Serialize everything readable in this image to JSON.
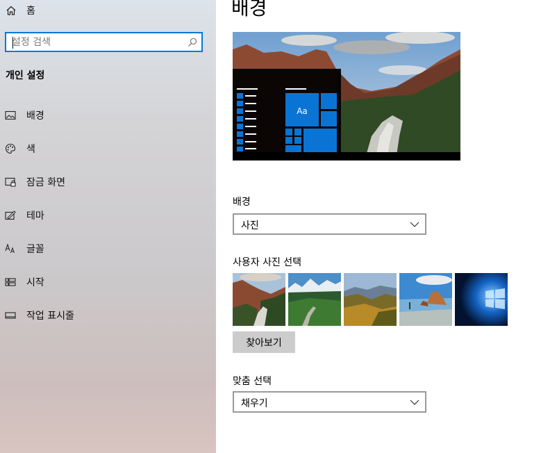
{
  "sidebar": {
    "home_label": "홈",
    "search_placeholder": "설정 검색",
    "section_title": "개인 설정",
    "items": [
      {
        "label": "배경",
        "icon": "picture-icon"
      },
      {
        "label": "색",
        "icon": "palette-icon"
      },
      {
        "label": "잠금 화면",
        "icon": "lock-screen-icon"
      },
      {
        "label": "테마",
        "icon": "theme-icon"
      },
      {
        "label": "글꼴",
        "icon": "font-icon"
      },
      {
        "label": "시작",
        "icon": "start-icon"
      },
      {
        "label": "작업 표시줄",
        "icon": "taskbar-icon"
      }
    ]
  },
  "main": {
    "title": "배경",
    "preview_tile_text": "Aa",
    "background_label": "배경",
    "background_value": "사진",
    "choose_photo_label": "사용자 사진 선택",
    "browse_label": "찾아보기",
    "fit_label": "맞춤 선택",
    "fit_value": "채우기"
  },
  "colors": {
    "accent": "#0078d7",
    "preview_tile": "#0a74d4"
  }
}
